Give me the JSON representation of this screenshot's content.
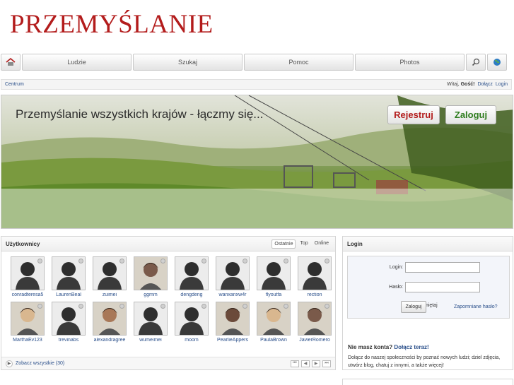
{
  "site": {
    "logo": "PRZEMYŚLANIE"
  },
  "nav": {
    "items": [
      {
        "label": "Ludzie"
      },
      {
        "label": "Szukaj"
      },
      {
        "label": "Pomoc"
      },
      {
        "label": "Photos"
      }
    ]
  },
  "crumbs": {
    "home": "Centrum",
    "greeting": "Witaj,",
    "guest": "Gość!",
    "join": "Dołącz",
    "login": "Login"
  },
  "hero": {
    "headline": "Przemyślanie wszystkich krajów - łączmy się...",
    "register": "Rejestruj",
    "login": "Zaloguj"
  },
  "users_panel": {
    "title": "Użytkownicy",
    "tabs": [
      "Ostatnie",
      "Top",
      "Online"
    ],
    "active_tab": "Ostatnie",
    "users": [
      {
        "name": "conradteresa5",
        "photo": false
      },
      {
        "name": "LaurenBeal",
        "photo": false
      },
      {
        "name": "zuimei",
        "photo": false
      },
      {
        "name": "ggmm",
        "photo": true
      },
      {
        "name": "dengdeng",
        "photo": false
      },
      {
        "name": "wanxanxw4r",
        "photo": false
      },
      {
        "name": "flyoutfa",
        "photo": false
      },
      {
        "name": "rection",
        "photo": false
      },
      {
        "name": "MarthaEv123",
        "photo": true
      },
      {
        "name": "trevinabs",
        "photo": false
      },
      {
        "name": "alexandragree",
        "photo": true
      },
      {
        "name": "wumeimei",
        "photo": false
      },
      {
        "name": "moom",
        "photo": false
      },
      {
        "name": "PearlieAppers",
        "photo": true
      },
      {
        "name": "PaulaBrown",
        "photo": true
      },
      {
        "name": "JavierRomero",
        "photo": true
      }
    ],
    "see_all": "Zobacz wszystkie (30)"
  },
  "login_panel": {
    "title": "Login",
    "login_label": "Login:",
    "password_label": "Hasło:",
    "remember": "Zapamiętaj",
    "submit": "Zaloguj",
    "forgot": "Zapomniane hasło?",
    "no_account": "Nie masz konta?",
    "join_now": "Dołącz teraz!",
    "description": "Dołącz do naszej społeczności by poznać nowych ludzi; dziel zdjęcia, utwórz blog, chatuj z innymi, a także więcej!"
  }
}
